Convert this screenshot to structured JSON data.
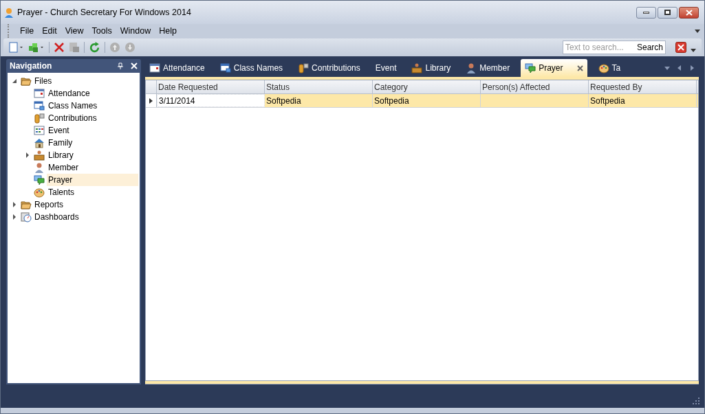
{
  "window": {
    "title": "Prayer - Church Secretary For Windows 2014"
  },
  "menu": [
    "File",
    "Edit",
    "View",
    "Tools",
    "Window",
    "Help"
  ],
  "search": {
    "placeholder": "Text to search...",
    "button": "Search"
  },
  "navigation": {
    "title": "Navigation",
    "tree": [
      {
        "label": "Files",
        "expanded": true,
        "children": [
          {
            "label": "Attendance",
            "selected": false
          },
          {
            "label": "Class Names",
            "selected": false
          },
          {
            "label": "Contributions",
            "selected": false
          },
          {
            "label": "Event",
            "selected": false
          },
          {
            "label": "Family",
            "selected": false
          },
          {
            "label": "Library",
            "selected": false,
            "expanded": false
          },
          {
            "label": "Member",
            "selected": false
          },
          {
            "label": "Prayer",
            "selected": true
          },
          {
            "label": "Talents",
            "selected": false
          }
        ]
      },
      {
        "label": "Reports",
        "expanded": false
      },
      {
        "label": "Dashboards",
        "expanded": false
      }
    ]
  },
  "tabs": [
    {
      "label": "Attendance",
      "selected": false
    },
    {
      "label": "Class Names",
      "selected": false
    },
    {
      "label": "Contributions",
      "selected": false
    },
    {
      "label": "Event",
      "selected": false
    },
    {
      "label": "Library",
      "selected": false
    },
    {
      "label": "Member",
      "selected": false
    },
    {
      "label": "Prayer",
      "selected": true
    },
    {
      "label": "Ta",
      "selected": false
    }
  ],
  "table": {
    "columns": [
      "Date Requested",
      "Status",
      "Category",
      "Person(s) Affected",
      "Requested By"
    ],
    "rows": [
      {
        "selected": true,
        "cells": [
          "3/11/2014",
          "Softpedia",
          "Softpedia",
          "",
          "Softpedia"
        ]
      }
    ]
  }
}
